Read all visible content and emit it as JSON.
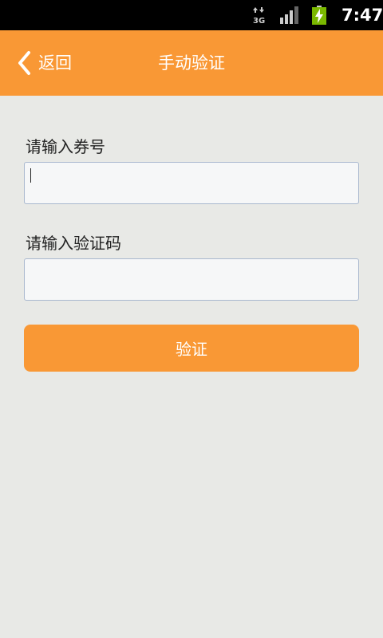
{
  "status_bar": {
    "network_type": "3G",
    "time": "7:47",
    "network_icon": "data-3g-icon",
    "signal_icon": "signal-strength-icon",
    "battery_icon": "battery-charging-icon"
  },
  "header": {
    "back_label": "返回",
    "title": "手动验证",
    "back_icon": "chevron-left-icon"
  },
  "form": {
    "coupon_label": "请输入券号",
    "coupon_value": "",
    "code_label": "请输入验证码",
    "code_value": "",
    "submit_label": "验证"
  },
  "colors": {
    "accent": "#f99835",
    "background": "#e8e9e6",
    "input_border": "#a9b8cf",
    "input_background": "#f6f7f8"
  }
}
